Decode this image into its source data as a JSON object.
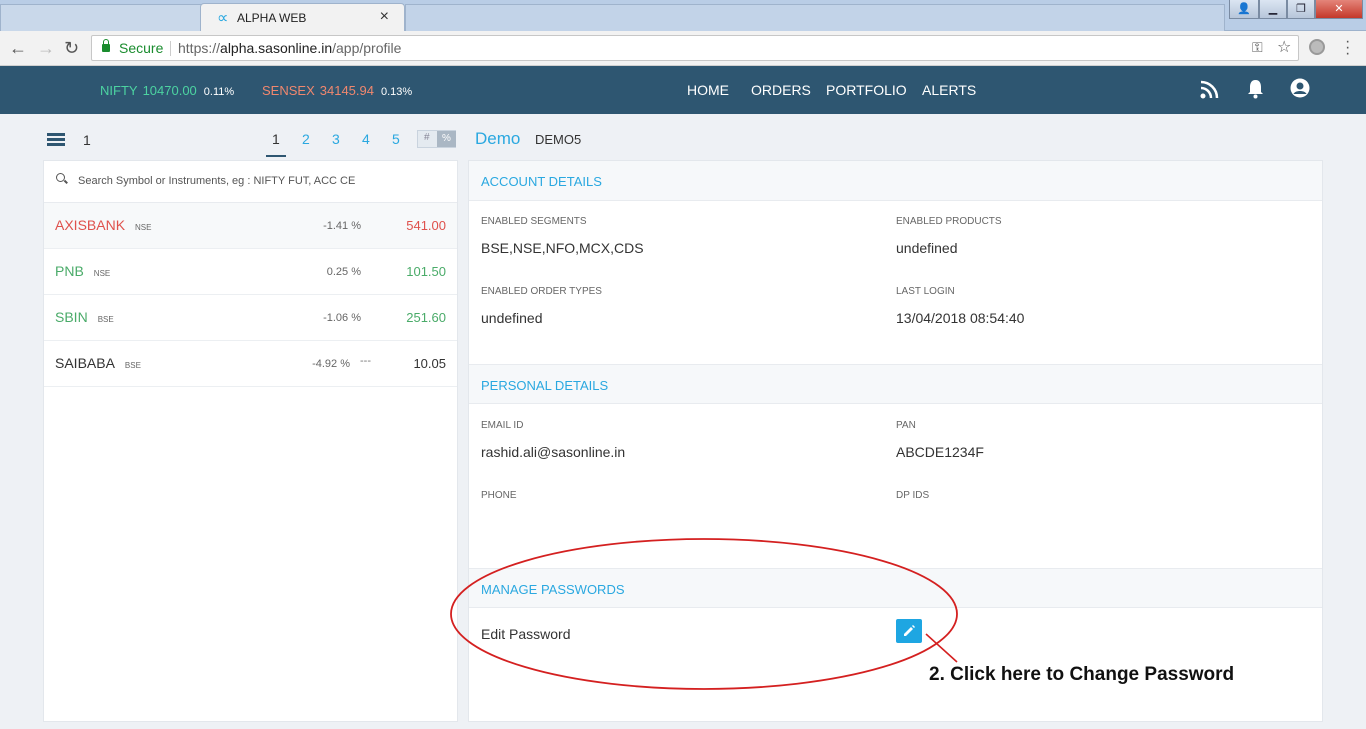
{
  "browser": {
    "tab_title": "ALPHA WEB",
    "tab_logo": "∝",
    "secure_label": "Secure",
    "url_scheme": "https://",
    "url_domain": "alpha.sasonline.in",
    "url_path": "/app/profile"
  },
  "header": {
    "tickers": [
      {
        "name": "NIFTY",
        "value": "10470.00",
        "change": "0.11%"
      },
      {
        "name": "SENSEX",
        "value": "34145.94",
        "change": "0.13%"
      }
    ],
    "nav": [
      "HOME",
      "ORDERS",
      "PORTFOLIO",
      "ALERTS"
    ],
    "icons": [
      "rss-icon",
      "bell-icon",
      "user-circle-icon"
    ]
  },
  "watchlist": {
    "current": "1",
    "pages": [
      "1",
      "2",
      "3",
      "4",
      "5"
    ],
    "active_page": "1",
    "toggle": [
      "#",
      "%"
    ],
    "search_placeholder": "Search Symbol or Instruments, eg : NIFTY FUT, ACC CE",
    "rows": [
      {
        "symbol": "AXISBANK",
        "exchange": "NSE",
        "change": "-1.41 %",
        "ltp": "541.00",
        "trend": "red"
      },
      {
        "symbol": "PNB",
        "exchange": "NSE",
        "change": "0.25 %",
        "ltp": "101.50",
        "trend": "green"
      },
      {
        "symbol": "SBIN",
        "exchange": "BSE",
        "change": "-1.06 %",
        "ltp": "251.60",
        "trend": "green"
      },
      {
        "symbol": "SAIBABA",
        "exchange": "BSE",
        "change": "-4.92 %",
        "dash": "---",
        "ltp": "10.05",
        "trend": "dark"
      }
    ]
  },
  "profile": {
    "name": "Demo",
    "client_id": "DEMO5",
    "account_details": {
      "title": "ACCOUNT DETAILS",
      "enabled_segments_label": "ENABLED SEGMENTS",
      "enabled_segments": "BSE,NSE,NFO,MCX,CDS",
      "enabled_products_label": "ENABLED PRODUCTS",
      "enabled_products": "undefined",
      "enabled_order_types_label": "ENABLED ORDER TYPES",
      "enabled_order_types": "undefined",
      "last_login_label": "LAST LOGIN",
      "last_login": "13/04/2018 08:54:40"
    },
    "personal_details": {
      "title": "PERSONAL DETAILS",
      "email_label": "EMAIL ID",
      "email": "rashid.ali@sasonline.in",
      "pan_label": "PAN",
      "pan": "ABCDE1234F",
      "phone_label": "PHONE",
      "phone": "",
      "dp_ids_label": "DP IDS",
      "dp_ids": ""
    },
    "manage_passwords": {
      "title": "MANAGE PASSWORDS",
      "edit_password_label": "Edit Password"
    }
  },
  "annotation": {
    "text": "2. Click here to Change Password",
    "color": "#d42020"
  }
}
